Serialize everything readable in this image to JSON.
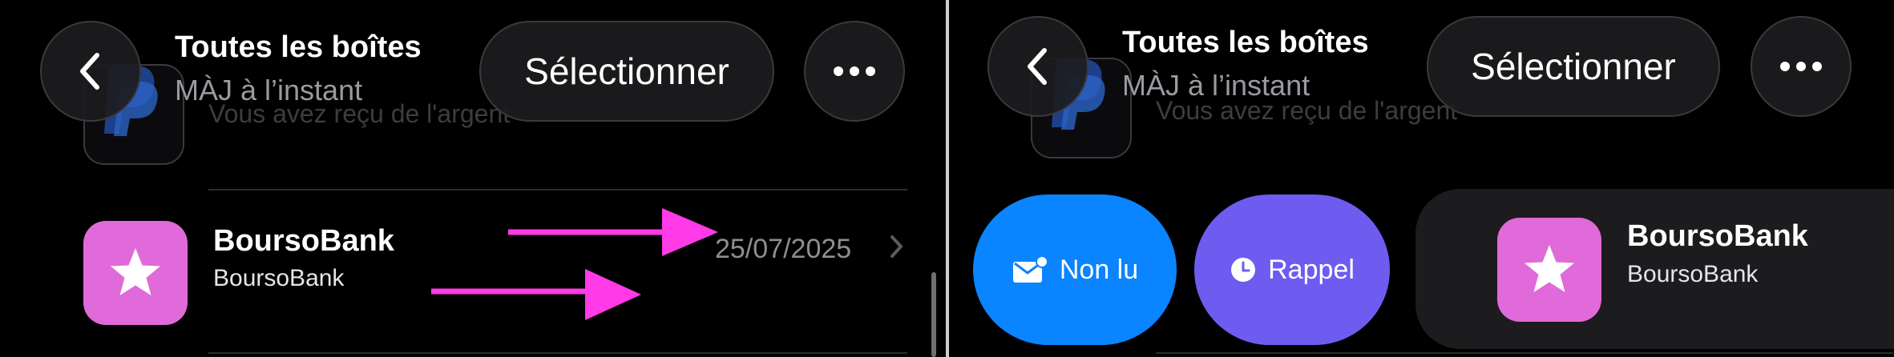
{
  "nav": {
    "title": "Toutes les boîtes",
    "subtitle": "MÀJ à l’instant",
    "select_label": "Sélectionner"
  },
  "previous_message": {
    "preview": "Vous avez reçu de l'argent"
  },
  "message": {
    "sender": "BoursoBank",
    "preview": "BoursoBank",
    "date": "25/07/2025"
  },
  "swipe_actions": {
    "unread_label": "Non lu",
    "remind_label": "Rappel"
  },
  "colors": {
    "arrow": "#ff3ae6",
    "app_icon": "#e06ad9",
    "unread": "#0a84ff",
    "remind": "#6e5cf0"
  },
  "icons": {
    "back": "chevron-left-icon",
    "more": "ellipsis-icon",
    "app": "star-icon",
    "unread": "envelope-badge-icon",
    "remind": "clock-icon",
    "disclosure": "chevron-right-icon"
  }
}
